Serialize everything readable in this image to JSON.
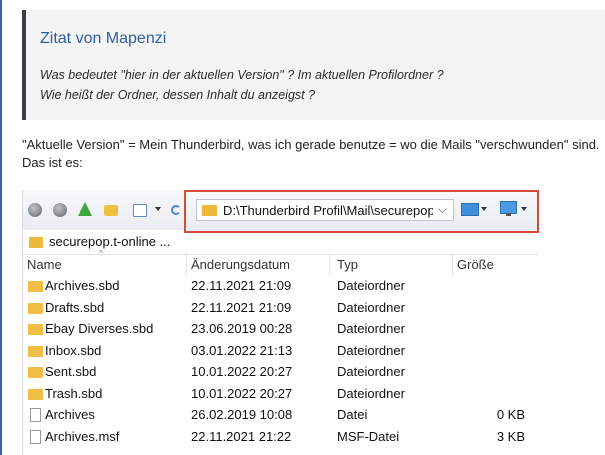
{
  "quote": {
    "title": "Zitat von Mapenzi",
    "line1": "Was bedeutet \"hier in der aktuellen Version\" ? Im aktuellen Profilordner ?",
    "line2": "Wie heißt der Ordner, dessen Inhalt du anzeigst ?"
  },
  "reply": {
    "line1": "\"Aktuelle Version\" = Mein Thunderbird, was ich gerade benutze = wo die Mails \"verschwunden\" sind.",
    "line2": "Das ist es:"
  },
  "explorer": {
    "address_path": "D:\\Thunderbird Profil\\Mail\\securepop.t-online.de",
    "breadcrumb": "securepop.t-online ...",
    "columns": {
      "name": "Name",
      "date": "Änderungsdatum",
      "type": "Typ",
      "size": "Größe"
    },
    "rows": [
      {
        "name": "Archives.sbd",
        "date": "22.11.2021 21:09",
        "type": "Dateiordner",
        "size": "",
        "kind": "folder"
      },
      {
        "name": "Drafts.sbd",
        "date": "22.11.2021 21:09",
        "type": "Dateiordner",
        "size": "",
        "kind": "folder"
      },
      {
        "name": "Ebay Diverses.sbd",
        "date": "23.06.2019 00:28",
        "type": "Dateiordner",
        "size": "",
        "kind": "folder"
      },
      {
        "name": "Inbox.sbd",
        "date": "03.01.2022 21:13",
        "type": "Dateiordner",
        "size": "",
        "kind": "folder"
      },
      {
        "name": "Sent.sbd",
        "date": "10.01.2022 20:27",
        "type": "Dateiordner",
        "size": "",
        "kind": "folder"
      },
      {
        "name": "Trash.sbd",
        "date": "10.01.2022 20:27",
        "type": "Dateiordner",
        "size": "",
        "kind": "folder"
      },
      {
        "name": "Archives",
        "date": "26.02.2019 10:08",
        "type": "Datei",
        "size": "0 KB",
        "kind": "file"
      },
      {
        "name": "Archives.msf",
        "date": "22.11.2021 21:22",
        "type": "MSF-Datei",
        "size": "3 KB",
        "kind": "file"
      }
    ]
  },
  "colors": {
    "accent": "#2d5fa6",
    "highlight": "#d64a3a",
    "folder": "#f0be44"
  }
}
